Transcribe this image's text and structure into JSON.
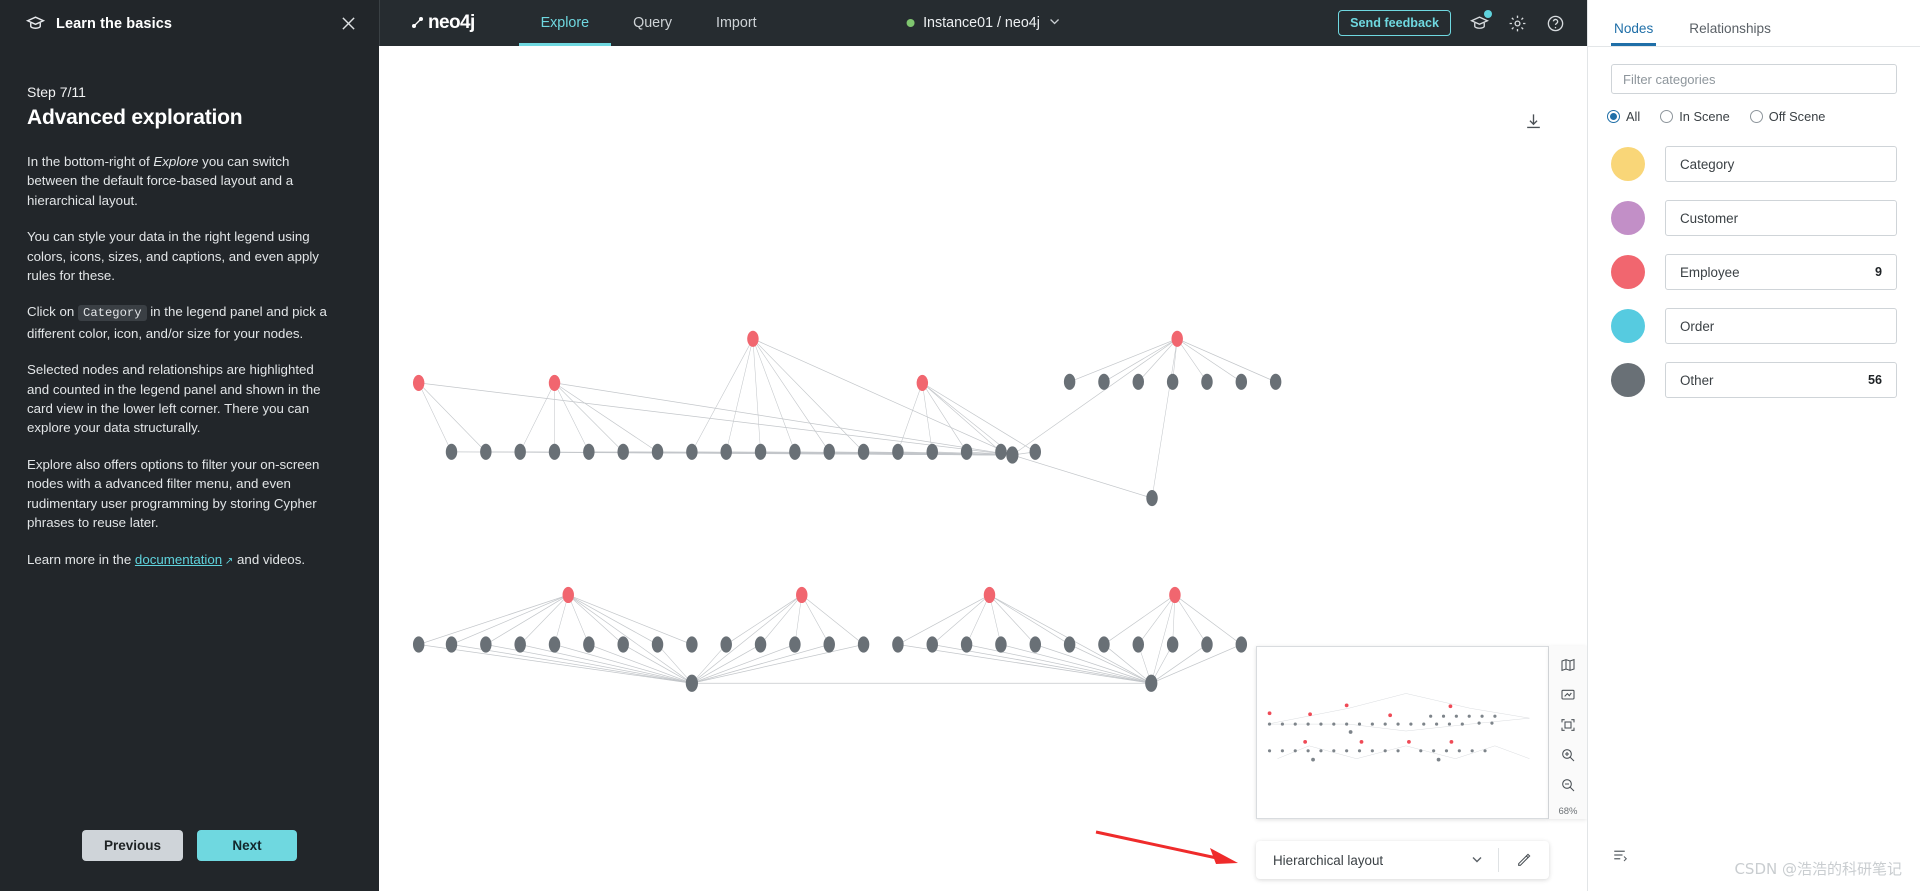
{
  "guide": {
    "header_title": "Learn the basics",
    "header_icon": "graduation-cap-icon",
    "close_icon": "close-icon",
    "step_label": "Step 7/11",
    "title": "Advanced exploration",
    "p1_a": "In the bottom-right of ",
    "p1_em": "Explore",
    "p1_b": " you can switch between the default force-based layout and a hierarchical layout.",
    "p2": "You can style your data in the right legend using colors, icons, sizes, and captions, and even apply rules for these.",
    "p3_a": "Click on ",
    "p3_code": "Category",
    "p3_b": " in the legend panel and pick a different color, icon, and/or size for your nodes.",
    "p4": "Selected nodes and relationships are highlighted and counted in the legend panel and shown in the card view in the lower left corner. There you can explore your data structurally.",
    "p5": "Explore also offers options to filter your on-screen nodes with a advanced filter menu, and even rudimentary user programming by storing Cypher phrases to reuse later.",
    "p6_a": "Learn more in the ",
    "p6_link": "documentation",
    "p6_b": " and videos.",
    "previous_label": "Previous",
    "next_label": "Next"
  },
  "topnav": {
    "logo": "neo4j",
    "links": [
      {
        "label": "Explore",
        "active": true
      },
      {
        "label": "Query",
        "active": false
      },
      {
        "label": "Import",
        "active": false
      }
    ],
    "instance": "Instance01 / neo4j",
    "instance_chevron": "chevron-down-icon",
    "feedback_label": "Send feedback",
    "icons": [
      "graduation-cap-icon",
      "gear-icon",
      "help-icon"
    ]
  },
  "canvas": {
    "download_icon": "download-icon",
    "minimap_tools": [
      "map-icon",
      "fit-to-screen-icon",
      "select-frame-icon",
      "zoom-in-icon",
      "zoom-out-icon"
    ],
    "zoom_level": "68%",
    "layout_value": "Hierarchical layout",
    "layout_chevron": "chevron-down-icon",
    "layout_edit_icon": "pencil-icon"
  },
  "legend": {
    "tabs": [
      {
        "label": "Nodes",
        "active": true
      },
      {
        "label": "Relationships",
        "active": false
      }
    ],
    "filter_placeholder": "Filter categories",
    "filter_value": "",
    "scope_options": [
      {
        "label": "All",
        "selected": true
      },
      {
        "label": "In Scene",
        "selected": false
      },
      {
        "label": "Off Scene",
        "selected": false
      }
    ],
    "categories": [
      {
        "name": "Category",
        "count": "",
        "color": "#f9d678"
      },
      {
        "name": "Customer",
        "count": "",
        "color": "#c28fc7"
      },
      {
        "name": "Employee",
        "count": "9",
        "color": "#f1666f"
      },
      {
        "name": "Order",
        "count": "",
        "color": "#56cbe0"
      },
      {
        "name": "Other",
        "count": "56",
        "color": "#697076"
      }
    ],
    "bottom_icon": "sort-lines-icon"
  },
  "watermark": "CSDN @浩浩的科研笔记",
  "colors": {
    "accent": "#6fd8e0",
    "panel_bg": "#22262a",
    "nav_bg": "#262c30",
    "tab_blue": "#1f6fa8",
    "node_gray": "#697076",
    "node_red": "#f1666f"
  }
}
